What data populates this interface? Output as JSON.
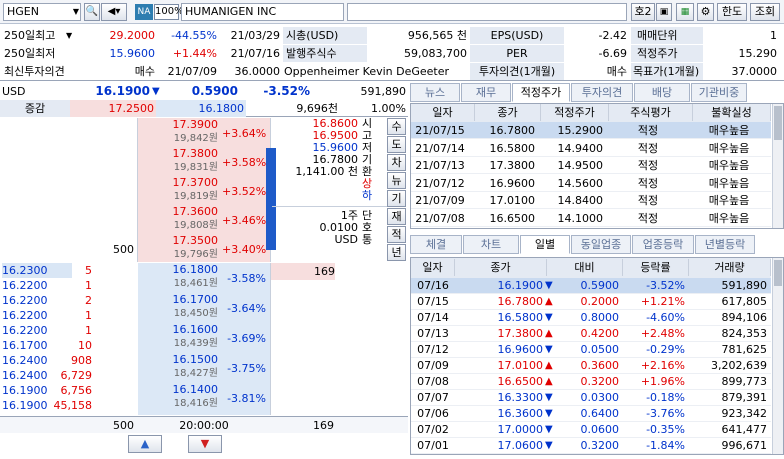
{
  "toolbar": {
    "symbol": "HGEN",
    "na_badge": "NA",
    "pct_badge": "100%",
    "company": "HUMANIGEN INC",
    "btn_ho2": "호2",
    "btn_hanto": "한도",
    "btn_query": "조회"
  },
  "summary": {
    "rows": [
      {
        "label": "250일최고",
        "price": "29.2000",
        "rate": "-44.55%",
        "date": "21/03/29",
        "k1": "시총(USD)",
        "v1": "956,565 천",
        "k2": "EPS(USD)",
        "v2": "-2.42",
        "k3": "매매단위",
        "v3": "1"
      },
      {
        "label": "250일최저",
        "price": "15.9600",
        "rate": "+1.44%",
        "date": "21/07/16",
        "k1": "발행주식수",
        "v1": "59,083,700",
        "k2": "PER",
        "v2": "-6.69",
        "k3": "적정주가",
        "v3": "15.290"
      },
      {
        "label": "최신투자의견",
        "price": "매수",
        "rate": "21/07/09",
        "date": "36.0000",
        "k1": "Oppenheimer Kevin DeGeeter",
        "v1": "",
        "k2": "투자의견(1개월)",
        "v2": "매수",
        "k3": "목표가(1개월)",
        "v3": "37.0000"
      }
    ]
  },
  "quote": {
    "currency": "USD",
    "price": "16.1900",
    "change": "0.5900",
    "rate": "-3.52%",
    "volume": "591,890",
    "inc_label": "증감",
    "ask_total": "17.2500",
    "bid_total": "16.1800",
    "qty_total": "9,696천",
    "ratio": "1.00%"
  },
  "asks": [
    {
      "price": "17.3900",
      "krw": "19,842원",
      "rate": "+3.64%",
      "qty": ""
    },
    {
      "price": "17.3800",
      "krw": "19,831원",
      "rate": "+3.58%",
      "qty": ""
    },
    {
      "price": "17.3700",
      "krw": "19,819원",
      "rate": "+3.52%",
      "qty": ""
    },
    {
      "price": "17.3600",
      "krw": "19,808원",
      "rate": "+3.46%",
      "qty": ""
    },
    {
      "price": "17.3500",
      "krw": "19,796원",
      "rate": "+3.40%",
      "qty": "500"
    }
  ],
  "bids": [
    {
      "price": "16.1800",
      "krw": "18,461원",
      "rate": "-3.58%",
      "qty": "169"
    },
    {
      "price": "16.1700",
      "krw": "18,450원",
      "rate": "-3.64%",
      "qty": ""
    },
    {
      "price": "16.1600",
      "krw": "18,439원",
      "rate": "-3.69%",
      "qty": ""
    },
    {
      "price": "16.1500",
      "krw": "18,427원",
      "rate": "-3.75%",
      "qty": ""
    },
    {
      "price": "16.1400",
      "krw": "18,416원",
      "rate": "-3.81%",
      "qty": ""
    }
  ],
  "side_info": {
    "high": "16.8600",
    "open": "16.9500",
    "low": "15.9600",
    "base": "16.7800",
    "amount": "1,141.00 천",
    "unit": "1주",
    "tick": "0.0100",
    "cur": "USD",
    "labels": [
      "시",
      "고",
      "저",
      "기",
      "환",
      "상",
      "하"
    ],
    "labels2": [
      "단",
      "호",
      "통"
    ],
    "vbtns": [
      "수",
      "도",
      "차",
      "뉴",
      "기",
      "재",
      "적",
      "년"
    ]
  },
  "ticks": [
    {
      "price": "16.2300",
      "qty": "5"
    },
    {
      "price": "16.2200",
      "qty": "1"
    },
    {
      "price": "16.2200",
      "qty": "2"
    },
    {
      "price": "16.2200",
      "qty": "1"
    },
    {
      "price": "16.2200",
      "qty": "1"
    },
    {
      "price": "16.1700",
      "qty": "10"
    },
    {
      "price": "16.2400",
      "qty": "908"
    },
    {
      "price": "16.2400",
      "qty": "6,729"
    },
    {
      "price": "16.1900",
      "qty": "6,756"
    },
    {
      "price": "16.1900",
      "qty": "45,158"
    }
  ],
  "footer": {
    "ask_sum": "500",
    "time": "20:00:00",
    "bid_sum": "169"
  },
  "tabs_top": [
    "뉴스",
    "재무",
    "적정주가",
    "투자의견",
    "배당",
    "기관비중"
  ],
  "fair_table": {
    "headers": [
      "일자",
      "종가",
      "적정주가",
      "주식평가",
      "불확실성"
    ],
    "rows": [
      [
        "21/07/15",
        "16.7800",
        "15.2900",
        "적정",
        "매우높음"
      ],
      [
        "21/07/14",
        "16.5800",
        "14.9400",
        "적정",
        "매우높음"
      ],
      [
        "21/07/13",
        "17.3800",
        "14.9500",
        "적정",
        "매우높음"
      ],
      [
        "21/07/12",
        "16.9600",
        "14.5600",
        "적정",
        "매우높음"
      ],
      [
        "21/07/09",
        "17.0100",
        "14.8400",
        "적정",
        "매우높음"
      ],
      [
        "21/07/08",
        "16.6500",
        "14.1000",
        "적정",
        "매우높음"
      ]
    ]
  },
  "tabs_bottom": [
    "체결",
    "차트",
    "일별",
    "동일업종",
    "업종등락",
    "년별등락"
  ],
  "daily_table": {
    "headers": [
      "일자",
      "종가",
      "대비",
      "등락률",
      "거래량"
    ],
    "rows": [
      {
        "date": "07/16",
        "close": "16.1900",
        "dir": "down",
        "diff": "0.5900",
        "rate": "-3.52%",
        "vol": "591,890"
      },
      {
        "date": "07/15",
        "close": "16.7800",
        "dir": "up",
        "diff": "0.2000",
        "rate": "+1.21%",
        "vol": "617,805"
      },
      {
        "date": "07/14",
        "close": "16.5800",
        "dir": "down",
        "diff": "0.8000",
        "rate": "-4.60%",
        "vol": "894,106"
      },
      {
        "date": "07/13",
        "close": "17.3800",
        "dir": "up",
        "diff": "0.4200",
        "rate": "+2.48%",
        "vol": "824,353"
      },
      {
        "date": "07/12",
        "close": "16.9600",
        "dir": "down",
        "diff": "0.0500",
        "rate": "-0.29%",
        "vol": "781,625"
      },
      {
        "date": "07/09",
        "close": "17.0100",
        "dir": "up",
        "diff": "0.3600",
        "rate": "+2.16%",
        "vol": "3,202,639"
      },
      {
        "date": "07/08",
        "close": "16.6500",
        "dir": "up",
        "diff": "0.3200",
        "rate": "+1.96%",
        "vol": "899,773"
      },
      {
        "date": "07/07",
        "close": "16.3300",
        "dir": "down",
        "diff": "0.0300",
        "rate": "-0.18%",
        "vol": "879,391"
      },
      {
        "date": "07/06",
        "close": "16.3600",
        "dir": "down",
        "diff": "0.6400",
        "rate": "-3.76%",
        "vol": "923,342"
      },
      {
        "date": "07/02",
        "close": "17.0000",
        "dir": "down",
        "diff": "0.0600",
        "rate": "-0.35%",
        "vol": "641,477"
      },
      {
        "date": "07/01",
        "close": "17.0600",
        "dir": "down",
        "diff": "0.3200",
        "rate": "-1.84%",
        "vol": "996,671"
      }
    ]
  },
  "colors": {
    "up": "#e00000",
    "down": "#0033cc",
    "accent": "#c9daf0"
  }
}
